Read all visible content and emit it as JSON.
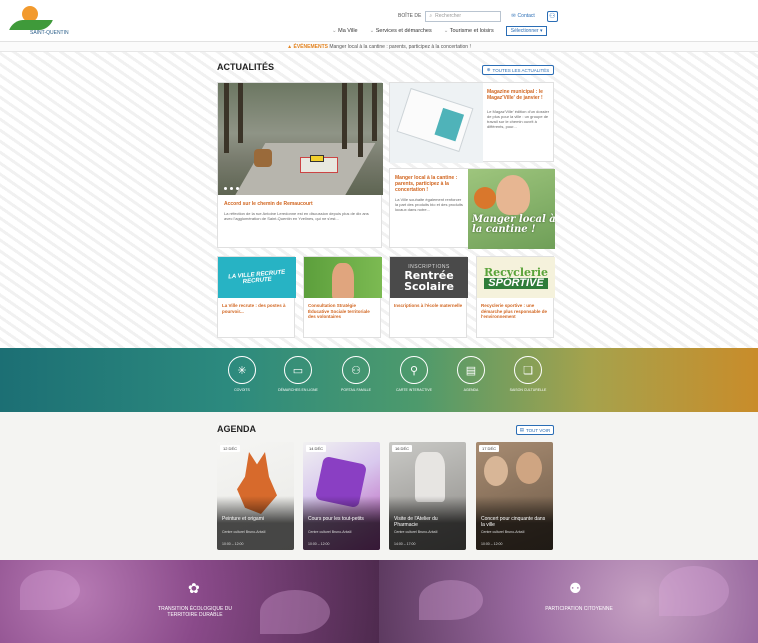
{
  "header": {
    "logo_tagline": "SAINT-QUENTIN",
    "access_label": "BOÎTE DE",
    "search_placeholder": "Rechercher",
    "contact_label": "Contact",
    "nav": [
      "Ma Ville",
      "Services et démarches",
      "Tourisme et loisirs"
    ],
    "select_label": "Sélectionner"
  },
  "alert": {
    "tag": "ÉVÉNEMENTS",
    "text": "Manger local à la cantine : parents, participez à la concertation !"
  },
  "news": {
    "title": "ACTUALITÉS",
    "all_button": "TOUTES LES ACTUALITÉS",
    "featured": {
      "title": "Accord sur le chemin de Remaucourt",
      "desc": "La réfection de la rue Antoine Leredonne est en discussion depuis plus de dix ans avec l'agglomération de Saint-Quentin en Yvelines, qui ne s'est..."
    },
    "side": [
      {
        "title": "Magazine municipal : le Magaz'Ville' de janvier !",
        "desc": "Le Magaz'Ville' édition d'un dossier de plus pour la ville : un groupe de travail sur le chemin ouvrit à différents, pour..."
      },
      {
        "title": "Manger local à la cantine : parents, participez à la concertation !",
        "desc": "La Ville souhaite également renforcer la part des produits bio et des produits locaux dans notre..."
      }
    ],
    "side2_slogan": "Manger local à la cantine !",
    "small": [
      {
        "title": "La Ville recrute : des postes à pourvoir...",
        "img_text": "LA VILLE RECRUTE RECRUTE"
      },
      {
        "title": "Consultation Stratégie Éducative Sociale territoriale des volontaires",
        "img_text": ""
      },
      {
        "title": "Inscriptions à l'école maternelle",
        "img_text_1": "INSCRIPTIONS",
        "img_text_2": "Rentrée Scolaire"
      },
      {
        "title": "Recyclerie sportive : une démarche plus responsable de l'environnement",
        "img_text_1": "Recyclerie",
        "img_text_2": "SPORTIVE"
      }
    ]
  },
  "quick_access": [
    {
      "icon": "sparkle-icon",
      "glyph": "✳",
      "label": "COVOITS"
    },
    {
      "icon": "laptop-icon",
      "glyph": "▭",
      "label": "DÉMARCHES EN LIGNE"
    },
    {
      "icon": "family-icon",
      "glyph": "⚇",
      "label": "PORTAIL FAMILLE"
    },
    {
      "icon": "map-pin-icon",
      "glyph": "⚲",
      "label": "CARTE INTERACTIVE"
    },
    {
      "icon": "calendar-icon",
      "glyph": "▤",
      "label": "AGENDA"
    },
    {
      "icon": "culture-icon",
      "glyph": "❏",
      "label": "SAISON CULTURELLE"
    }
  ],
  "agenda": {
    "title": "AGENDA",
    "all_button": "TOUT VOIR",
    "events": [
      {
        "date": "12 DÉC",
        "title": "Peinture et origami",
        "loc": "Centre culturel Bruno-Arbaïl",
        "hours": "10:00 – 12:00"
      },
      {
        "date": "14 DÉC",
        "title": "Cours pour les tout-petits",
        "loc": "Centre culturel Bruno-Arbaïl",
        "hours": "10:00 – 12:00"
      },
      {
        "date": "16 DÉC",
        "title": "Visite de l'Atelier du Pharmacie",
        "loc": "Centre culturel Bruno-Arbaïl",
        "hours": "14:00 – 17:00"
      },
      {
        "date": "17 DÉC",
        "title": "Concert pour cinquante dans la ville",
        "loc": "Centre culturel Bruno-Arbaïl",
        "hours": "10:00 – 12:00"
      }
    ]
  },
  "bottom": [
    {
      "icon": "plant-hand-icon",
      "glyph": "✿",
      "label": "TRANSITION ÉCOLOGIQUE DU TERRITOIRE DURABLE"
    },
    {
      "icon": "citizens-icon",
      "glyph": "⚉",
      "label": "PARTICIPATION CITOYENNE"
    }
  ]
}
